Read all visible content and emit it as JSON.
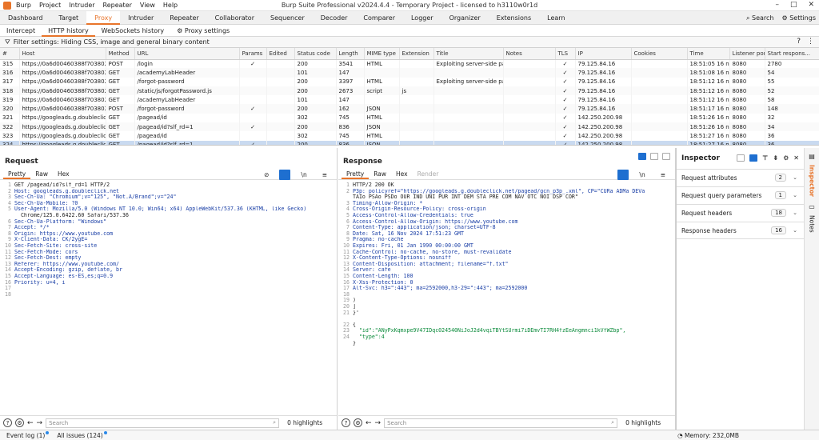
{
  "titlebar": {
    "menu": [
      "Burp",
      "Project",
      "Intruder",
      "Repeater",
      "View",
      "Help"
    ],
    "title": "Burp Suite Professional v2024.4.4 - Temporary Project - licensed to h3110w0r1d"
  },
  "tooltabs": [
    "Dashboard",
    "Target",
    "Proxy",
    "Intruder",
    "Repeater",
    "Collaborator",
    "Sequencer",
    "Decoder",
    "Comparer",
    "Logger",
    "Organizer",
    "Extensions",
    "Learn"
  ],
  "tooltabs_right": {
    "search": "Search",
    "settings": "Settings"
  },
  "subtabs": [
    "Intercept",
    "HTTP history",
    "WebSockets history",
    "Proxy settings"
  ],
  "filter": "Filter settings: Hiding CSS, image and general binary content",
  "columns": [
    "#",
    "Host",
    "Method",
    "URL",
    "Params",
    "Edited",
    "Status code",
    "Length",
    "MIME type",
    "Extension",
    "Title",
    "Notes",
    "TLS",
    "IP",
    "Cookies",
    "Time",
    "Listener port",
    "Start respons..."
  ],
  "rows": [
    [
      "315",
      "https://0a6d00460388f703802f4...",
      "POST",
      "/login",
      "✓",
      "",
      "200",
      "3541",
      "HTML",
      "",
      "Exploiting server-side pa...",
      "",
      "✓",
      "79.125.84.16",
      "",
      "18:51:05 16 n...",
      "8080",
      "2780"
    ],
    [
      "316",
      "https://0a6d00460388f703802f4...",
      "GET",
      "/academyLabHeader",
      "",
      "",
      "101",
      "147",
      "",
      "",
      "",
      "",
      "✓",
      "79.125.84.16",
      "",
      "18:51:08 16 n...",
      "8080",
      "54"
    ],
    [
      "317",
      "https://0a6d00460388f703802f4...",
      "GET",
      "/forgot-password",
      "",
      "",
      "200",
      "3397",
      "HTML",
      "",
      "Exploiting server-side pa...",
      "",
      "✓",
      "79.125.84.16",
      "",
      "18:51:12 16 n...",
      "8080",
      "55"
    ],
    [
      "318",
      "https://0a6d00460388f703802f4...",
      "GET",
      "/static/js/forgotPassword.js",
      "",
      "",
      "200",
      "2673",
      "script",
      "js",
      "",
      "",
      "✓",
      "79.125.84.16",
      "",
      "18:51:12 16 n...",
      "8080",
      "52"
    ],
    [
      "319",
      "https://0a6d00460388f703802f4...",
      "GET",
      "/academyLabHeader",
      "",
      "",
      "101",
      "147",
      "",
      "",
      "",
      "",
      "✓",
      "79.125.84.16",
      "",
      "18:51:12 16 n...",
      "8080",
      "58"
    ],
    [
      "320",
      "https://0a6d00460388f703802f4...",
      "POST",
      "/forgot-password",
      "✓",
      "",
      "200",
      "162",
      "JSON",
      "",
      "",
      "",
      "✓",
      "79.125.84.16",
      "",
      "18:51:17 16 n...",
      "8080",
      "148"
    ],
    [
      "321",
      "https://googleads.g.doubleclick...",
      "GET",
      "/pagead/id",
      "",
      "",
      "302",
      "745",
      "HTML",
      "",
      "",
      "",
      "✓",
      "142.250.200.98",
      "",
      "18:51:26 16 n...",
      "8080",
      "32"
    ],
    [
      "322",
      "https://googleads.g.doubleclick...",
      "GET",
      "/pagead/id?slf_rd=1",
      "✓",
      "",
      "200",
      "836",
      "JSON",
      "",
      "",
      "",
      "✓",
      "142.250.200.98",
      "",
      "18:51:26 16 n...",
      "8080",
      "34"
    ],
    [
      "323",
      "https://googleads.g.doubleclick...",
      "GET",
      "/pagead/id",
      "",
      "",
      "302",
      "745",
      "HTML",
      "",
      "",
      "",
      "✓",
      "142.250.200.98",
      "",
      "18:51:27 16 n...",
      "8080",
      "36"
    ],
    [
      "324",
      "https://googleads.g.doubleclick...",
      "GET",
      "/pagead/id?slf_rd=1",
      "✓",
      "",
      "200",
      "836",
      "JSON",
      "",
      "",
      "",
      "✓",
      "142.250.200.98",
      "",
      "18:51:27 16 n...",
      "8080",
      "36"
    ]
  ],
  "request": {
    "title": "Request",
    "tabs": [
      "Pretty",
      "Raw",
      "Hex"
    ],
    "lines": [
      "GET /pagead/id?slf_rd=1 HTTP/2",
      "Host: googleads.g.doubleclick.net",
      "Sec-Ch-Ua: \"Chromium\";v=\"125\", \"Not.A/Brand\";v=\"24\"",
      "Sec-Ch-Ua-Mobile: ?0",
      "User-Agent: Mozilla/5.0 (Windows NT 10.0; Win64; x64) AppleWebKit/537.36 (KHTML, like Gecko)",
      "  Chrome/125.0.6422.60 Safari/537.36",
      "Sec-Ch-Ua-Platform: \"Windows\"",
      "Accept: */*",
      "Origin: https://www.youtube.com",
      "X-Client-Data: CK/2ygE=",
      "Sec-Fetch-Site: cross-site",
      "Sec-Fetch-Mode: cors",
      "Sec-Fetch-Dest: empty",
      "Referer: https://www.youtube.com/",
      "Accept-Encoding: gzip, deflate, br",
      "Accept-Language: es-ES,es;q=0.9",
      "Priority: u=4, i",
      "",
      ""
    ],
    "line_numbers": [
      "1",
      "2",
      "3",
      "4",
      "5",
      "",
      "6",
      "7",
      "8",
      "9",
      "10",
      "11",
      "12",
      "13",
      "14",
      "15",
      "16",
      "17",
      "18"
    ],
    "search_placeholder": "Search",
    "highlights": "0 highlights"
  },
  "response": {
    "title": "Response",
    "tabs": [
      "Pretty",
      "Raw",
      "Hex",
      "Render"
    ],
    "lines": [
      "HTTP/2 200 OK",
      "P3p: policyref=\"https://googleads.g.doubleclick.net/pagead/gcn_p3p_.xml\", CP=\"CURa ADMa DEVa",
      "TAIo PSAo PSDo OUR IND UNI PUR INT DEM STA PRE COM NAV OTC NOI DSP COR\"",
      "Timing-Allow-Origin: *",
      "Cross-Origin-Resource-Policy: cross-origin",
      "Access-Control-Allow-Credentials: true",
      "Access-Control-Allow-Origin: https://www.youtube.com",
      "Content-Type: application/json; charset=UTF-8",
      "Date: Sat, 16 Nov 2024 17:51:23 GMT",
      "Pragma: no-cache",
      "Expires: Fri, 01 Jan 1990 00:00:00 GMT",
      "Cache-Control: no-cache, no-store, must-revalidate",
      "X-Content-Type-Options: nosniff",
      "Content-Disposition: attachment; filename=\"f.txt\"",
      "Server: cafe",
      "Content-Length: 100",
      "X-Xss-Protection: 0",
      "Alt-Svc: h3=\":443\"; ma=2592000,h3-29=\":443\"; ma=2592000",
      "",
      ")",
      "]",
      "}'",
      "",
      "{",
      "  \"id\":\"ANyPxKqmxpe9V47IDqc024540NiJoJ2d4vqiTBYtSUrmi7iDEmvTI7RH4fzEeAngmnci1kVfWZbp\",",
      "  \"type\":4",
      "}"
    ],
    "line_numbers": [
      "1",
      "2",
      "",
      "3",
      "4",
      "5",
      "6",
      "7",
      "8",
      "9",
      "10",
      "11",
      "12",
      "13",
      "14",
      "15",
      "16",
      "17",
      "18",
      "19",
      "20",
      "21",
      "",
      "22",
      "23",
      "24",
      ""
    ],
    "search_placeholder": "Search",
    "highlights": "0 highlights"
  },
  "inspector": {
    "title": "Inspector",
    "sections": [
      {
        "label": "Request attributes",
        "count": "2"
      },
      {
        "label": "Request query parameters",
        "count": "1"
      },
      {
        "label": "Request headers",
        "count": "18"
      },
      {
        "label": "Response headers",
        "count": "16"
      }
    ],
    "sidetabs": [
      "Inspector",
      "Notes"
    ]
  },
  "status": {
    "event_log": "Event log (1)",
    "all_issues": "All issues (124)",
    "memory": "Memory: 232,0MB"
  },
  "colors": {
    "accent": "#e8742a",
    "selected_row": "#c9daf0",
    "toggle_on": "#1e6fd0"
  }
}
